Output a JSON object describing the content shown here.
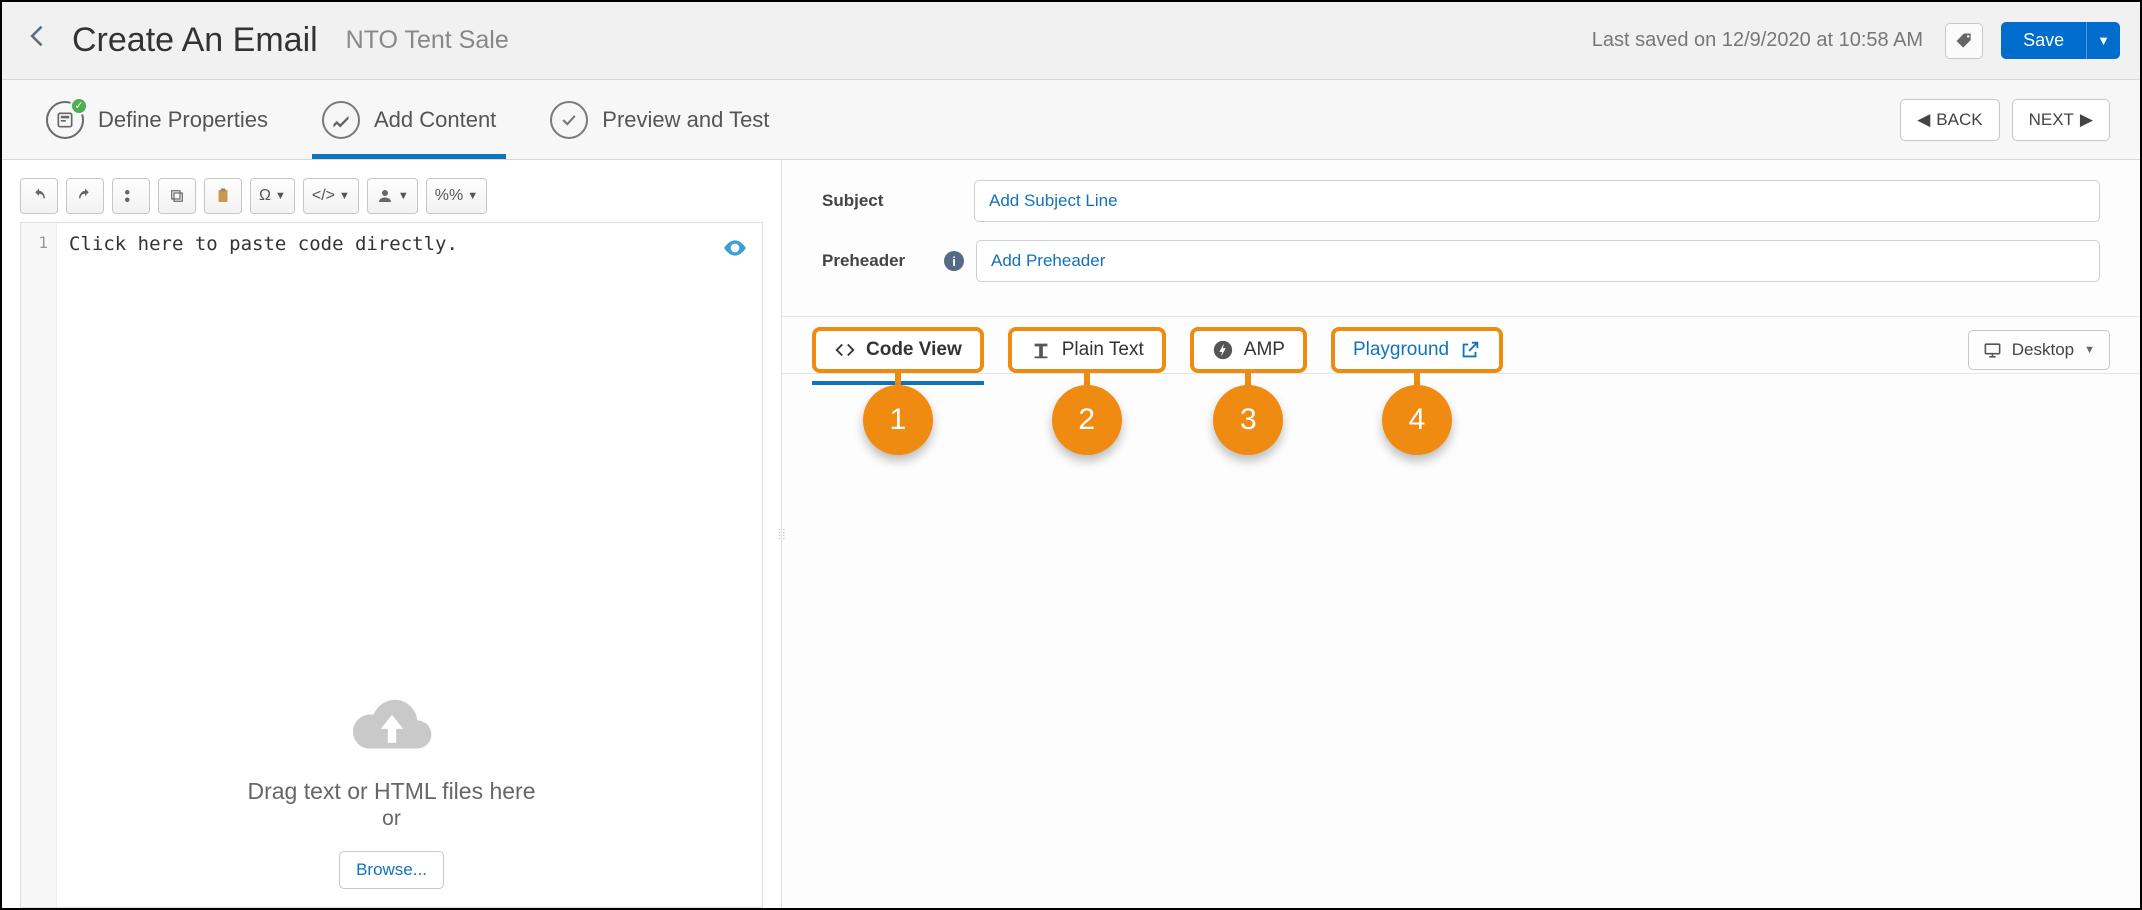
{
  "header": {
    "title": "Create An Email",
    "subtitle": "NTO Tent Sale",
    "last_saved": "Last saved on 12/9/2020 at 10:58 AM",
    "save_label": "Save"
  },
  "wizard": {
    "steps": [
      {
        "label": "Define Properties"
      },
      {
        "label": "Add Content"
      },
      {
        "label": "Preview and Test"
      }
    ],
    "back_label": "BACK",
    "next_label": "NEXT"
  },
  "toolbar": {
    "undo": "undo",
    "redo": "redo",
    "cut": "cut",
    "copy": "copy",
    "paste": "paste",
    "omega": "Ω",
    "code": "</>",
    "person": "person",
    "percent": "%%"
  },
  "editor": {
    "line1_number": "1",
    "placeholder_text": "Click here to paste code directly.",
    "drop_text": "Drag text or HTML files here",
    "drop_or": "or",
    "browse_label": "Browse..."
  },
  "fields": {
    "subject_label": "Subject",
    "subject_placeholder": "Add Subject Line",
    "preheader_label": "Preheader",
    "preheader_placeholder": "Add Preheader"
  },
  "view_tabs": {
    "code_view": "Code View",
    "plain_text": "Plain Text",
    "amp": "AMP",
    "playground": "Playground",
    "desktop": "Desktop"
  },
  "annotations": {
    "a1": "1",
    "a2": "2",
    "a3": "3",
    "a4": "4"
  }
}
